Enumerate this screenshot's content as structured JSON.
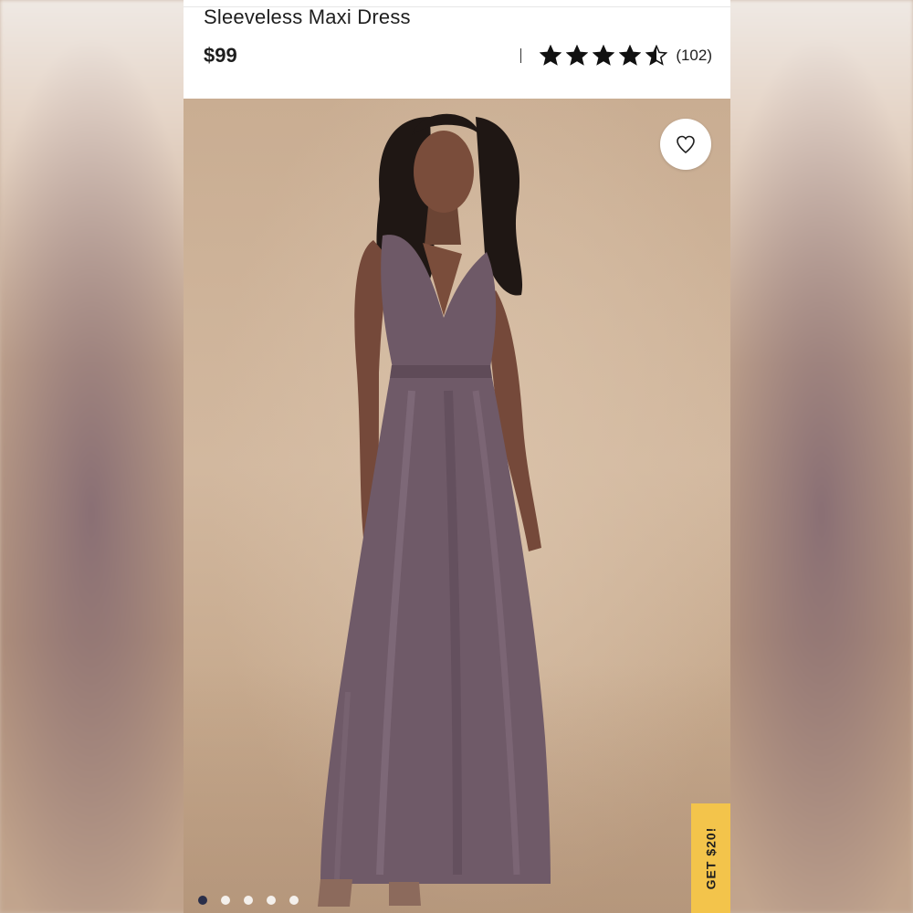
{
  "product": {
    "title": "Sleeveless Maxi Dress",
    "price": "$99",
    "rating": 4.5,
    "stars_max": 5,
    "review_count": "(102)"
  },
  "image": {
    "favorite_icon": "heart-icon",
    "carousel": {
      "total": 5,
      "active": 1
    }
  },
  "promo": {
    "label": "GET $20!",
    "color": "#f3c44b"
  },
  "colors": {
    "dress": "#6f5a68",
    "backdrop": "#c9ad92"
  }
}
